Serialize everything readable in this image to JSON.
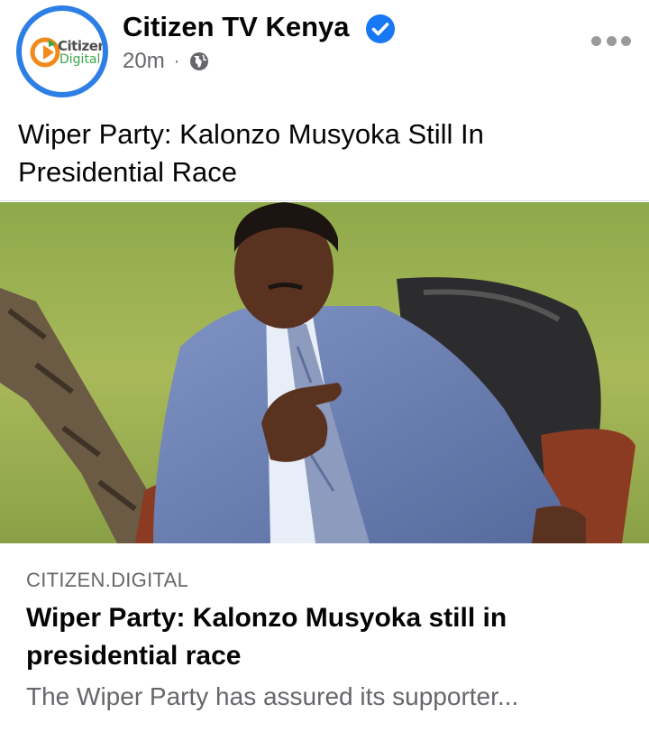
{
  "header": {
    "avatar_logo_line1": "Citizen",
    "avatar_logo_line2": "Digital",
    "page_name": "Citizen TV Kenya",
    "time_ago": "20m",
    "separator": "·",
    "verified_icon": "verified-badge-icon",
    "privacy_icon": "globe-icon",
    "more_icon": "more-horizontal-icon"
  },
  "post": {
    "text": "Wiper Party: Kalonzo Musyoka Still In Presidential Race"
  },
  "link_preview": {
    "domain": "CITIZEN.DIGITAL",
    "title": "Wiper Party: Kalonzo Musyoka still in presidential race",
    "description": "The Wiper Party has assured its supporter..."
  },
  "colors": {
    "avatar_ring": "#2d7fe6",
    "verified_blue": "#1877f2",
    "secondary_text": "#65676b",
    "logo_orange": "#f08a1c",
    "logo_green": "#3aa84a"
  }
}
